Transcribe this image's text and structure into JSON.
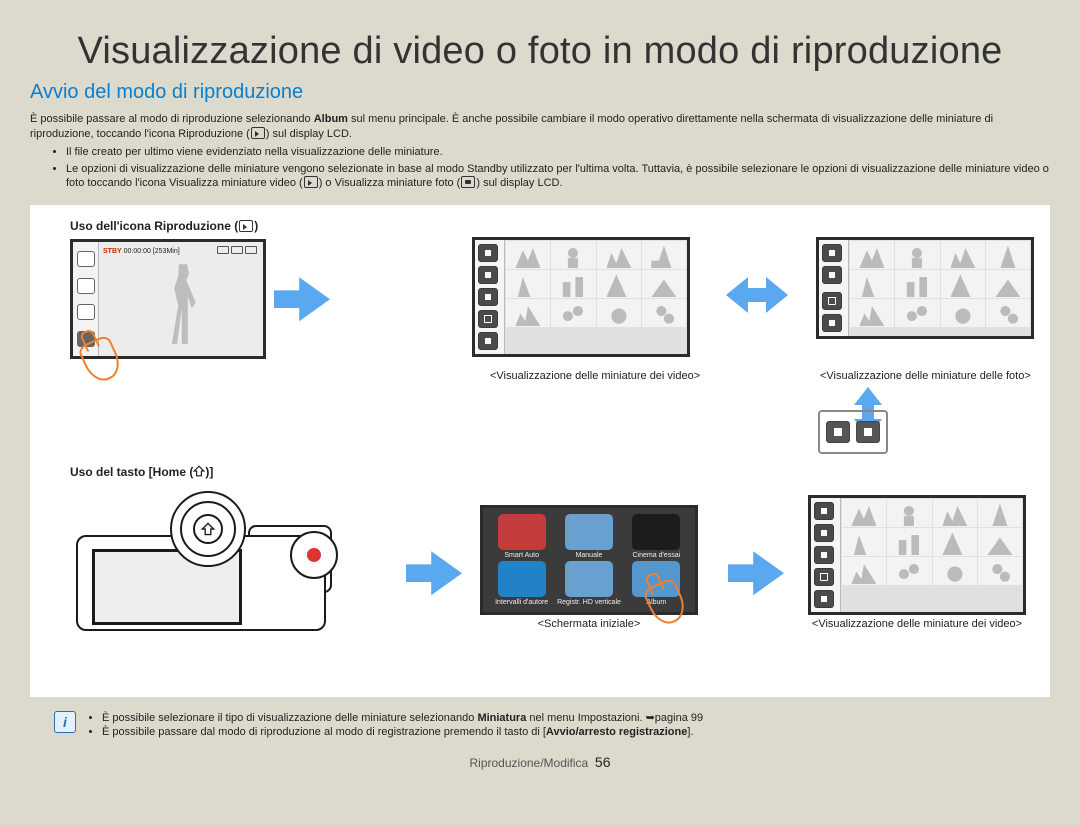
{
  "page_title": "Visualizzazione di video o foto in modo di riproduzione",
  "section_title": "Avvio del modo di riproduzione",
  "intro_p1a": "È possibile passare al modo di riproduzione selezionando ",
  "intro_p1_bold1": "Album",
  "intro_p1b": " sul menu principale. È anche possibile cambiare il modo operativo direttamente nella schermata di visualizzazione delle miniature di riproduzione, toccando l'icona Riproduzione (",
  "intro_p1c": ") sul display LCD.",
  "bullet1": "Il file creato per ultimo viene evidenziato nella visualizzazione delle miniature.",
  "bullet2a": "Le opzioni di visualizzazione delle miniature vengono selezionate in base al modo Standby utilizzato per l'ultima volta. Tuttavia, è possibile selezionare le opzioni di visualizzazione delle miniature video o foto toccando l'icona Visualizza miniature video (",
  "bullet2b": ") o Visualizza miniature foto (",
  "bullet2c": ") sul display LCD.",
  "heading_play_icon": "Uso dell'icona Riproduzione (",
  "heading_play_icon_end": ")",
  "lcd_top": {
    "stby": "STBY",
    "time": "00:00:00",
    "remain": "[253Min]"
  },
  "caption_video_thumbs": "<Visualizzazione delle miniature dei video>",
  "caption_photo_thumbs": "<Visualizzazione delle miniature delle foto>",
  "heading_home": "Uso del tasto [Home (",
  "heading_home_end": ")]",
  "home_apps": {
    "a0": "Smart Auto",
    "a1": "Manuale",
    "a2": "Cinema d'essai",
    "a3": "Intervalli d'autore",
    "a4": "Registr. HD verticale",
    "a5": "Album"
  },
  "caption_home": "<Schermata iniziale>",
  "note1a": "È possibile selezionare il tipo di visualizzazione delle miniature selezionando ",
  "note1_bold": "Miniatura",
  "note1b": " nel menu Impostazioni. ➥pagina 99",
  "note2a": "È possibile passare dal modo di riproduzione al modo di registrazione premendo il tasto di [",
  "note2_bold": "Avvio/arresto registrazione",
  "note2b": "].",
  "footer_section": "Riproduzione/Modifica",
  "footer_page": "56"
}
